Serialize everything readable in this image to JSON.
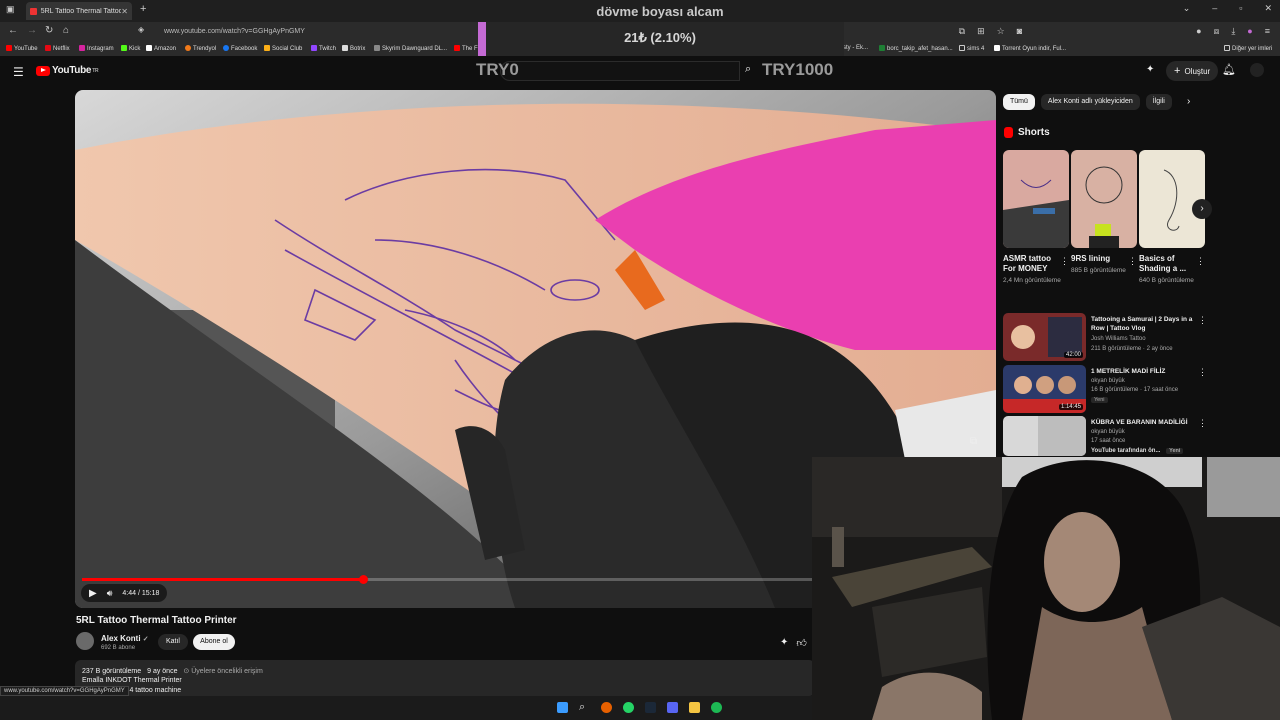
{
  "browser": {
    "tab_title": "5RL Tattoo Thermal Tattoo Printer",
    "url": "www.youtube.com/watch?v=GGHgAyPnGMY",
    "bookmarks": [
      "YouTube",
      "Netflix",
      "Instagram",
      "Kick",
      "Amazon",
      "Trendyol",
      "Facebook",
      "Social Club",
      "Twitch",
      "Botrix",
      "Skyrim Dawnguard DL...",
      "The F",
      "tasty - Ek...",
      "borc_takip_afet_hasan...",
      "sims 4",
      "Torrent Oyun indir, Ful...",
      "Diğer yer imleri"
    ],
    "status_url": "www.youtube.com/watch?v=GGHgAyPnGMY"
  },
  "overlay": {
    "title": "dövme boyası alcam",
    "amount": "21₺ (2.10%)",
    "progress_fraction": 0.021,
    "min_label": "TRY0",
    "max_label": "TRY1000"
  },
  "youtube": {
    "logo": "YouTube",
    "logo_sup": "TR",
    "create_label": "Oluştur",
    "player": {
      "time_current": "4:44",
      "time_total": "15:18",
      "progress_fraction": 0.31
    },
    "video": {
      "title": "5RL Tattoo Thermal Tattoo Printer",
      "channel": "Alex Konti",
      "subscribers": "692 B abone",
      "join_label": "Katıl",
      "subscribe_label": "Abone ol",
      "views": "237 B görüntüleme",
      "age": "9 ay önce",
      "early_access": "Üyelere öncelikli erişim",
      "desc_line1": "Emalla INKDOT Thermal Printer",
      "desc_line2": "G4 tattoo machine"
    },
    "chips": [
      "Tümü",
      "Alex Konti adlı yükleyiciden",
      "İlgili"
    ],
    "shorts_heading": "Shorts",
    "shorts": [
      {
        "title": "ASMR tattoo For MONEY",
        "views": "2,4 Mn görüntüleme"
      },
      {
        "title": "9RS lining",
        "views": "885 B görüntüleme"
      },
      {
        "title": "Basics of Shading a ...",
        "views": "640 B görüntüleme"
      }
    ],
    "recommendations": [
      {
        "title": "Tattooing a Samurai | 2 Days in a Row | Tattoo Vlog",
        "channel": "Josh Williams Tattoo",
        "meta": "211 B görüntüleme · 2 ay önce",
        "duration": "42:00",
        "badge": ""
      },
      {
        "title": "1 METRELİK MADİ FİLİZ",
        "channel": "okyan büyük",
        "meta": "16 B görüntüleme · 17 saat önce",
        "duration": "1:14:45",
        "badge": "Yeni"
      },
      {
        "title": "KÜBRA VE BARANIN MADİLİĞİ",
        "channel": "okyan büyük",
        "meta": "17 saat önce",
        "duration": "",
        "badge": ""
      }
    ],
    "rec3_extra": "YouTube tarafından ön...",
    "rec3_badge": "Yeni"
  },
  "colors": {
    "accent_red": "#ff0000",
    "overlay_fill": "#c46ad4",
    "bg": "#0f0f0f"
  }
}
